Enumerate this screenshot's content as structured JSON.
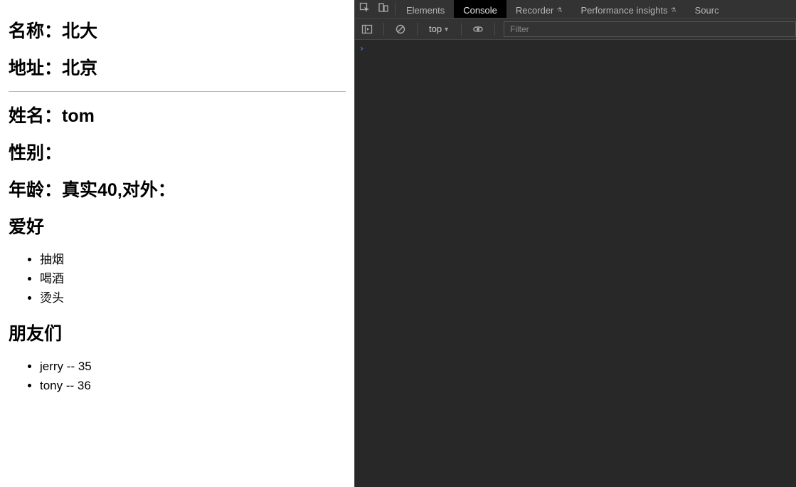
{
  "page": {
    "school": {
      "name_label": "名称：",
      "name_value": "北大",
      "address_label": "地址：",
      "address_value": "北京"
    },
    "person": {
      "name_label": "姓名：",
      "name_value": "tom",
      "gender_label": "性别：",
      "gender_value": "",
      "age_label": "年龄：",
      "age_prefix": "真实",
      "age_real": "40",
      "age_middle": ",对外：",
      "age_public": ""
    },
    "hobbies": {
      "title": "爱好",
      "items": [
        "抽烟",
        "喝酒",
        "烫头"
      ]
    },
    "friends": {
      "title": "朋友们",
      "items": [
        {
          "name": "jerry",
          "sep": " -- ",
          "age": "35"
        },
        {
          "name": "tony",
          "sep": " -- ",
          "age": "36"
        }
      ]
    }
  },
  "devtools": {
    "tabs": {
      "elements": "Elements",
      "console": "Console",
      "recorder": "Recorder",
      "performance_insights": "Performance insights",
      "sources": "Sourc"
    },
    "toolbar": {
      "context": "top",
      "filter_placeholder": "Filter"
    },
    "console": {
      "prompt": "›"
    }
  }
}
